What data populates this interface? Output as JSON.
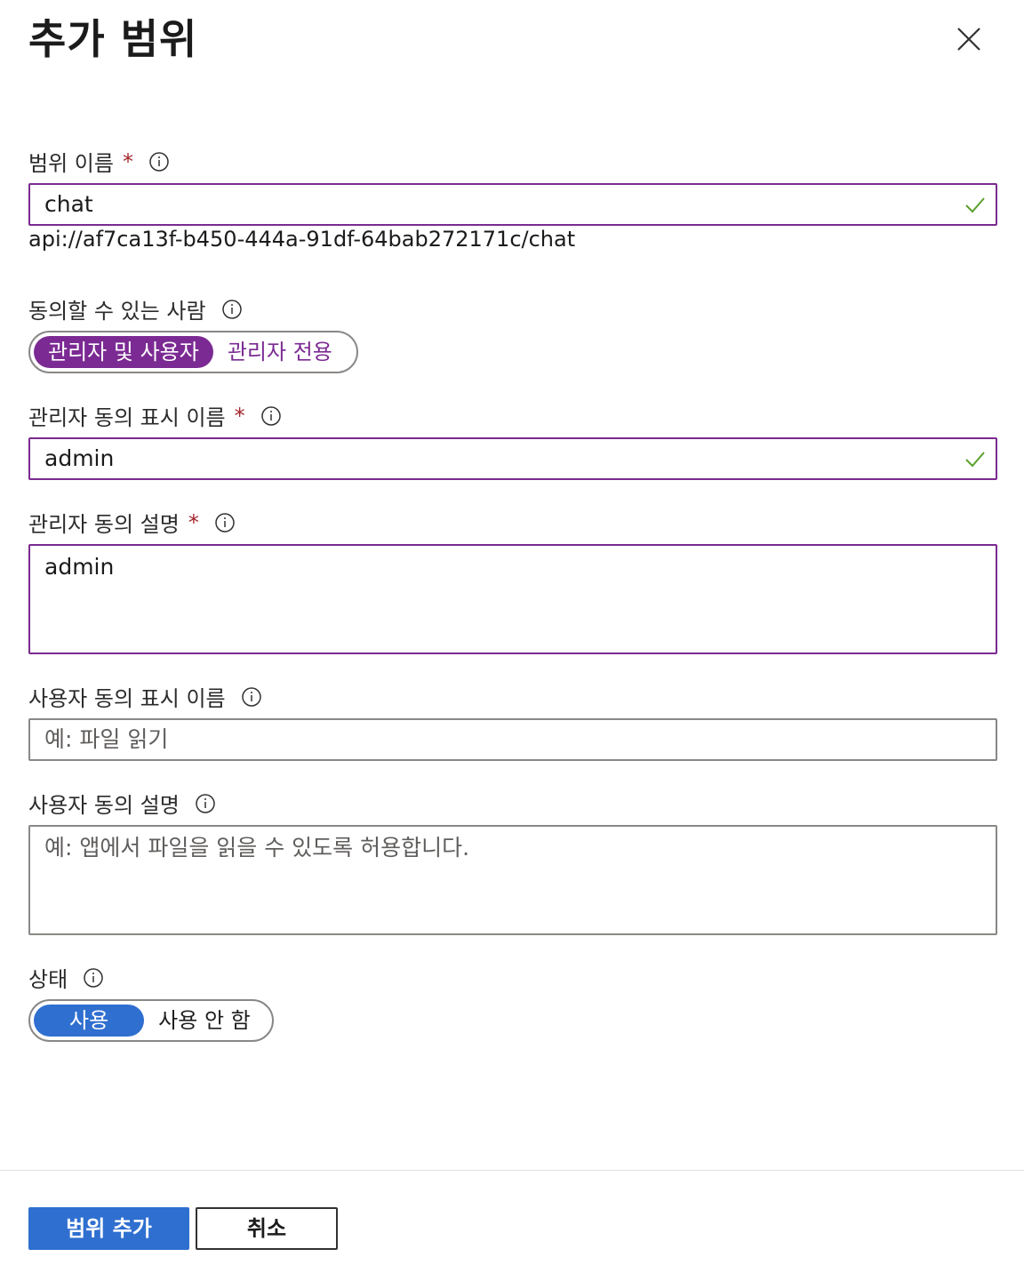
{
  "panel": {
    "title": "추가 범위"
  },
  "scope_name": {
    "label": "범위 이름",
    "required": "*",
    "value": "chat",
    "uri": "api://af7ca13f-b450-444a-91df-64bab272171c/chat"
  },
  "consent_who": {
    "label": "동의할 수 있는 사람",
    "options": [
      "관리자 및 사용자",
      "관리자 전용"
    ],
    "selected": "관리자 및 사용자"
  },
  "admin_display": {
    "label": "관리자 동의 표시 이름",
    "required": "*",
    "value": "admin"
  },
  "admin_desc": {
    "label": "관리자 동의 설명",
    "required": "*",
    "value": "admin"
  },
  "user_display": {
    "label": "사용자 동의 표시 이름",
    "placeholder": "예: 파일 읽기"
  },
  "user_desc": {
    "label": "사용자 동의 설명",
    "placeholder": "예: 앱에서 파일을 읽을 수 있도록 허용합니다."
  },
  "state": {
    "label": "상태",
    "options": [
      "사용",
      "사용 안 함"
    ],
    "selected": "사용"
  },
  "footer": {
    "add_label": "범위 추가",
    "cancel_label": "취소"
  },
  "colors": {
    "accent_purple": "#7b2a93",
    "primary_blue": "#2f6fd0",
    "valid_green": "#5aa02c",
    "required_red": "#a4262c"
  },
  "icons": {
    "close": "close-icon",
    "info": "info-icon",
    "check": "checkmark-icon"
  }
}
